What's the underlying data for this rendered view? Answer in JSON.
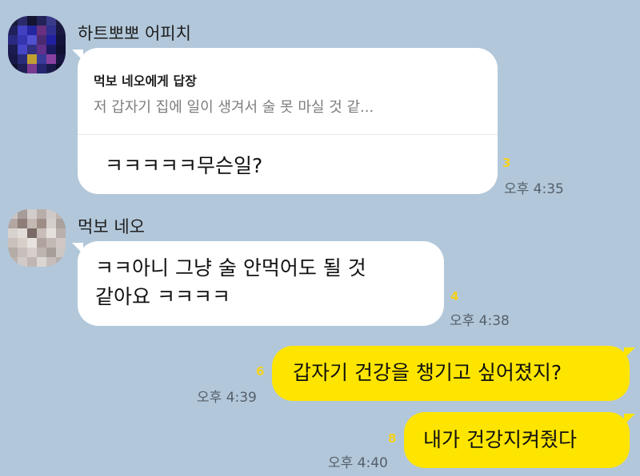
{
  "messages": [
    {
      "sender": "하트뽀뽀 어피치",
      "reply": {
        "title": "먹보 네오에게 답장",
        "preview": "저 갑자기 집에 일이 생겨서 술 못 마실 것 같..."
      },
      "text": "ㅋㅋㅋㅋㅋ무슨일?",
      "unread": "3",
      "time": "오후 4:35"
    },
    {
      "sender": "먹보 네오",
      "text_line1": "ㅋㅋ아니 그냥 술 안먹어도 될 것",
      "text_line2": "같아요 ㅋㅋㅋㅋ",
      "unread": "4",
      "time": "오후 4:38"
    },
    {
      "text": "갑자기 건강을 챙기고 싶어졌지?",
      "unread": "6",
      "time": "오후 4:39"
    },
    {
      "text": "내가 건강지켜줬다",
      "unread": "8",
      "time": "오후 4:40"
    }
  ],
  "colors": {
    "background": "#b2c7da",
    "incoming_bubble": "#ffffff",
    "outgoing_bubble": "#fee500",
    "unread_count": "#f6d21c"
  }
}
